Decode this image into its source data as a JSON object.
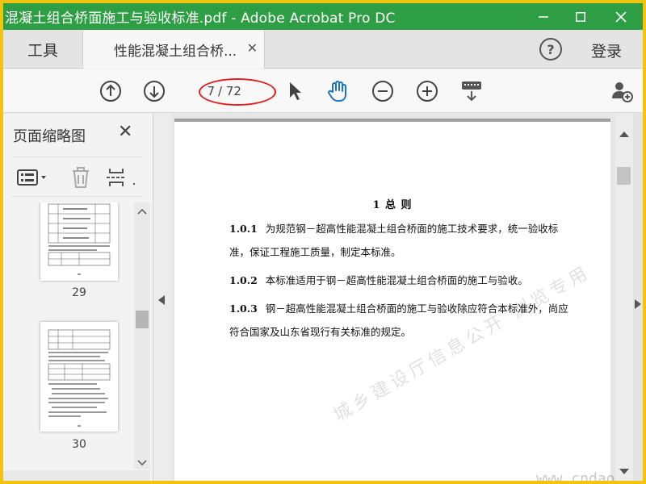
{
  "window": {
    "title": "混凝土组合桥面施工与验收标准.pdf - Adobe Acrobat Pro DC",
    "minimize_icon": "minimize-icon",
    "maximize_icon": "maximize-icon",
    "close_icon": "close-icon"
  },
  "tabs": {
    "tools_label": "工具",
    "doc_label": "性能混凝土组合桥...",
    "help_label": "?",
    "login_label": "登录"
  },
  "toolbar": {
    "current_page": "7",
    "total_pages": "/ 72",
    "icons": [
      "prev-page-icon",
      "next-page-icon",
      "select-tool-icon",
      "hand-tool-icon",
      "zoom-out-icon",
      "zoom-in-icon",
      "keyboard-icon",
      "add-user-icon"
    ],
    "accent": "#1a73c8"
  },
  "sidebar": {
    "title": "页面缩略图",
    "thumbnails": [
      {
        "page_label": "29"
      },
      {
        "page_label": "30"
      }
    ]
  },
  "document": {
    "heading": "1 总 则",
    "paragraphs": [
      {
        "num": "1.0.1",
        "text": "为规范钢－超高性能混凝土组合桥面的施工技术要求，统一验收标准，保证工程施工质量，制定本标准。"
      },
      {
        "num": "1.0.2",
        "text": "本标准适用于钢－超高性能混凝土组合桥面的施工与验收。"
      },
      {
        "num": "1.0.3",
        "text": "钢－超高性能混凝土组合桥面的施工与验收除应符合本标准外，尚应符合国家及山东省现行有关标准的规定。"
      }
    ],
    "watermark": "城乡建设厅信息公开 浏览专用",
    "site_mark": "www.cndao.com"
  },
  "colors": {
    "titlebar": "#2e9e44",
    "outer_border": "#f1c40f",
    "annotation": "#e02020"
  }
}
